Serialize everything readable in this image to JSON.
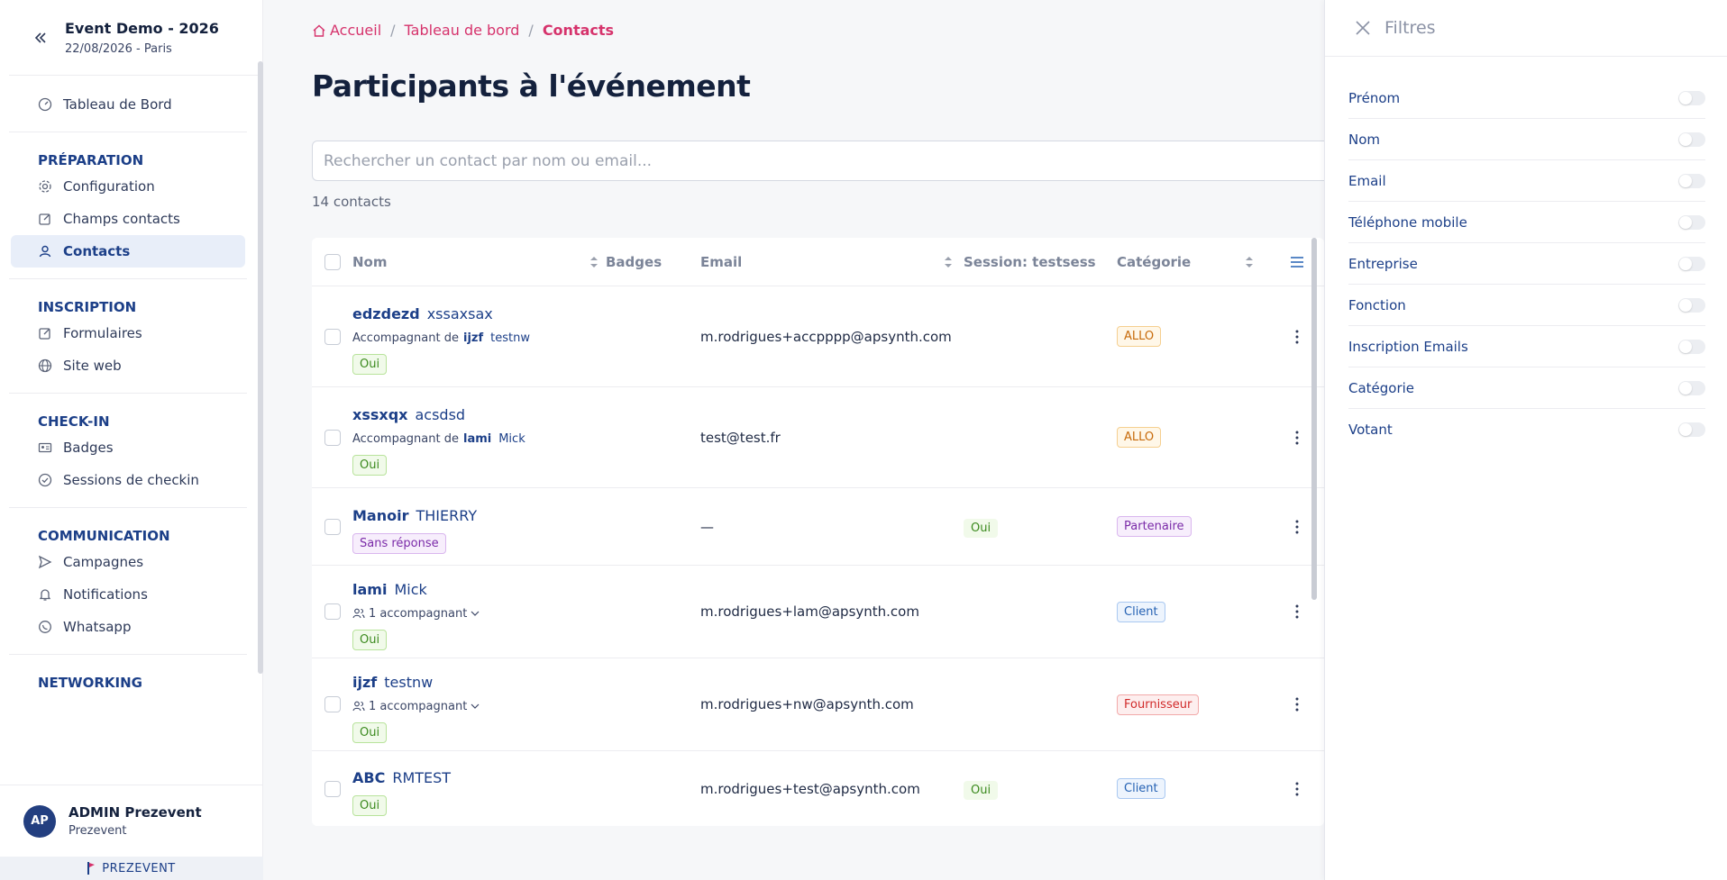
{
  "event": {
    "title": "Event Demo - 2026",
    "subtitle": "22/08/2026 - Paris"
  },
  "sidebar": {
    "top_items": [
      {
        "label": "Tableau de Bord",
        "icon": "gauge-icon"
      }
    ],
    "sections": [
      {
        "title": "PRÉPARATION",
        "items": [
          {
            "label": "Configuration",
            "icon": "gear-icon"
          },
          {
            "label": "Champs contacts",
            "icon": "edit-icon"
          },
          {
            "label": "Contacts",
            "icon": "user-icon",
            "active": true
          }
        ]
      },
      {
        "title": "INSCRIPTION",
        "items": [
          {
            "label": "Formulaires",
            "icon": "edit-icon"
          },
          {
            "label": "Site web",
            "icon": "globe-icon"
          }
        ]
      },
      {
        "title": "CHECK-IN",
        "items": [
          {
            "label": "Badges",
            "icon": "badge-icon"
          },
          {
            "label": "Sessions de checkin",
            "icon": "check-circle-icon"
          }
        ]
      },
      {
        "title": "COMMUNICATION",
        "items": [
          {
            "label": "Campagnes",
            "icon": "send-icon"
          },
          {
            "label": "Notifications",
            "icon": "bell-icon"
          },
          {
            "label": "Whatsapp",
            "icon": "whatsapp-icon"
          }
        ]
      },
      {
        "title": "NETWORKING",
        "items": []
      }
    ],
    "user": {
      "initials": "AP",
      "name": "ADMIN Prezevent",
      "org": "Prezevent"
    },
    "brand": "PREZEVENT"
  },
  "breadcrumb": {
    "home": "Accueil",
    "middle": "Tableau de bord",
    "current": "Contacts"
  },
  "page_title": "Participants à l'événement",
  "search": {
    "placeholder": "Rechercher un contact par nom ou email..."
  },
  "count": "14 contacts",
  "table": {
    "headers": {
      "nom": "Nom",
      "badges": "Badges",
      "email": "Email",
      "session": "Session: testsess",
      "categorie": "Catégorie"
    },
    "rows": [
      {
        "first": "edzdezd",
        "last": "xssaxsax",
        "acc_prefix": "Accompagnant de",
        "acc_first": "ijzf",
        "acc_last": "testnw",
        "status": "Oui",
        "email": "m.rodrigues+accpppp@apsynth.com",
        "session": "",
        "categorie": "ALLO"
      },
      {
        "first": "xssxqx",
        "last": "acsdsd",
        "acc_prefix": "Accompagnant de",
        "acc_first": "lami",
        "acc_last": "Mick",
        "status": "Oui",
        "email": "test@test.fr",
        "session": "",
        "categorie": "ALLO"
      },
      {
        "first": "Manoir",
        "last": "THIERRY",
        "status": "Sans réponse",
        "email": "—",
        "session": "Oui",
        "categorie": "Partenaire"
      },
      {
        "first": "lami",
        "last": "Mick",
        "acc_count": "1 accompagnant",
        "status": "Oui",
        "email": "m.rodrigues+lam@apsynth.com",
        "session": "",
        "categorie": "Client"
      },
      {
        "first": "ijzf",
        "last": "testnw",
        "acc_count": "1 accompagnant",
        "status": "Oui",
        "email": "m.rodrigues+nw@apsynth.com",
        "session": "",
        "categorie": "Fournisseur"
      },
      {
        "first": "ABC",
        "last": "RMTEST",
        "status": "Oui",
        "email": "m.rodrigues+test@apsynth.com",
        "session": "Oui",
        "categorie": "Client"
      }
    ]
  },
  "filters": {
    "title": "Filtres",
    "items": [
      "Prénom",
      "Nom",
      "Email",
      "Téléphone mobile",
      "Entreprise",
      "Fonction",
      "Inscription Emails",
      "Catégorie",
      "Votant"
    ]
  },
  "colors": {
    "primary": "#1c3f88",
    "accent": "#d6336c",
    "avatar": "#233f80"
  }
}
